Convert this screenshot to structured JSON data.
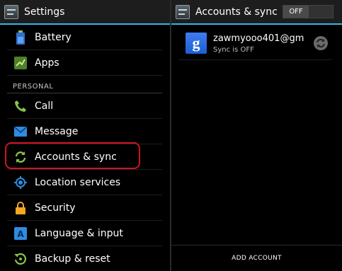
{
  "left_pane": {
    "title": "Settings",
    "items_top": [
      {
        "label": "Battery",
        "icon": "battery-icon"
      },
      {
        "label": "Apps",
        "icon": "apps-icon"
      }
    ],
    "section_header": "PERSONAL",
    "items_personal": [
      {
        "label": "Call",
        "icon": "phone-icon"
      },
      {
        "label": "Message",
        "icon": "envelope-icon"
      },
      {
        "label": "Accounts & sync",
        "icon": "sync-icon"
      },
      {
        "label": "Location services",
        "icon": "location-icon"
      },
      {
        "label": "Security",
        "icon": "lock-icon"
      },
      {
        "label": "Language & input",
        "icon": "keyboard-a-icon"
      },
      {
        "label": "Backup & reset",
        "icon": "backup-icon"
      }
    ]
  },
  "right_pane": {
    "title": "Accounts & sync",
    "toggle_label": "OFF",
    "account": {
      "name": "zawmyooo401@gm",
      "status": "Sync is OFF",
      "icon_letter": "g"
    },
    "footer_button": "ADD ACCOUNT"
  },
  "colors": {
    "accent": "#33b5e5",
    "highlight_outline": "#d0141e",
    "icon_green": "#8bc34a",
    "icon_blue": "#2f8be0",
    "icon_orange": "#f5a623"
  }
}
